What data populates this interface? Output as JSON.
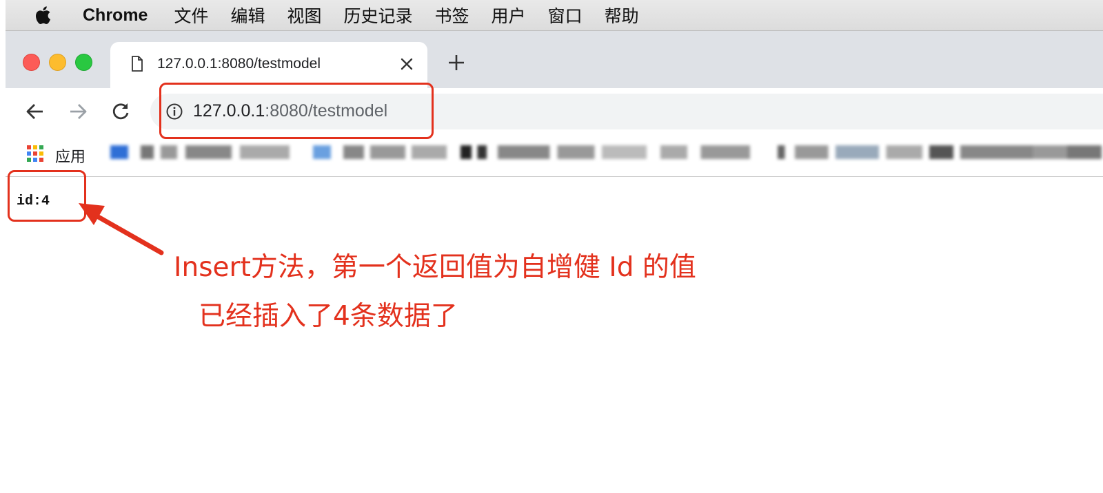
{
  "menubar": {
    "app_name": "Chrome",
    "items": [
      "文件",
      "编辑",
      "视图",
      "历史记录",
      "书签",
      "用户",
      "窗口",
      "帮助"
    ]
  },
  "tab": {
    "title": "127.0.0.1:8080/testmodel",
    "new_tab_label": "+"
  },
  "address_bar": {
    "host": "127.0.0.1",
    "path": ":8080/testmodel"
  },
  "bookmarks": {
    "apps_label": "应用"
  },
  "page": {
    "content": "id:4"
  },
  "annotation": {
    "line1": "Insert方法，第一个返回值为自增健 Id 的值",
    "line2": "已经插入了4条数据了",
    "color": "#e3311d"
  },
  "colors": {
    "tab_strip": "#dee1e6",
    "omnibox": "#f1f3f4",
    "close": "#fc5b57",
    "minimize": "#fdbc2e",
    "zoom": "#29c841"
  }
}
